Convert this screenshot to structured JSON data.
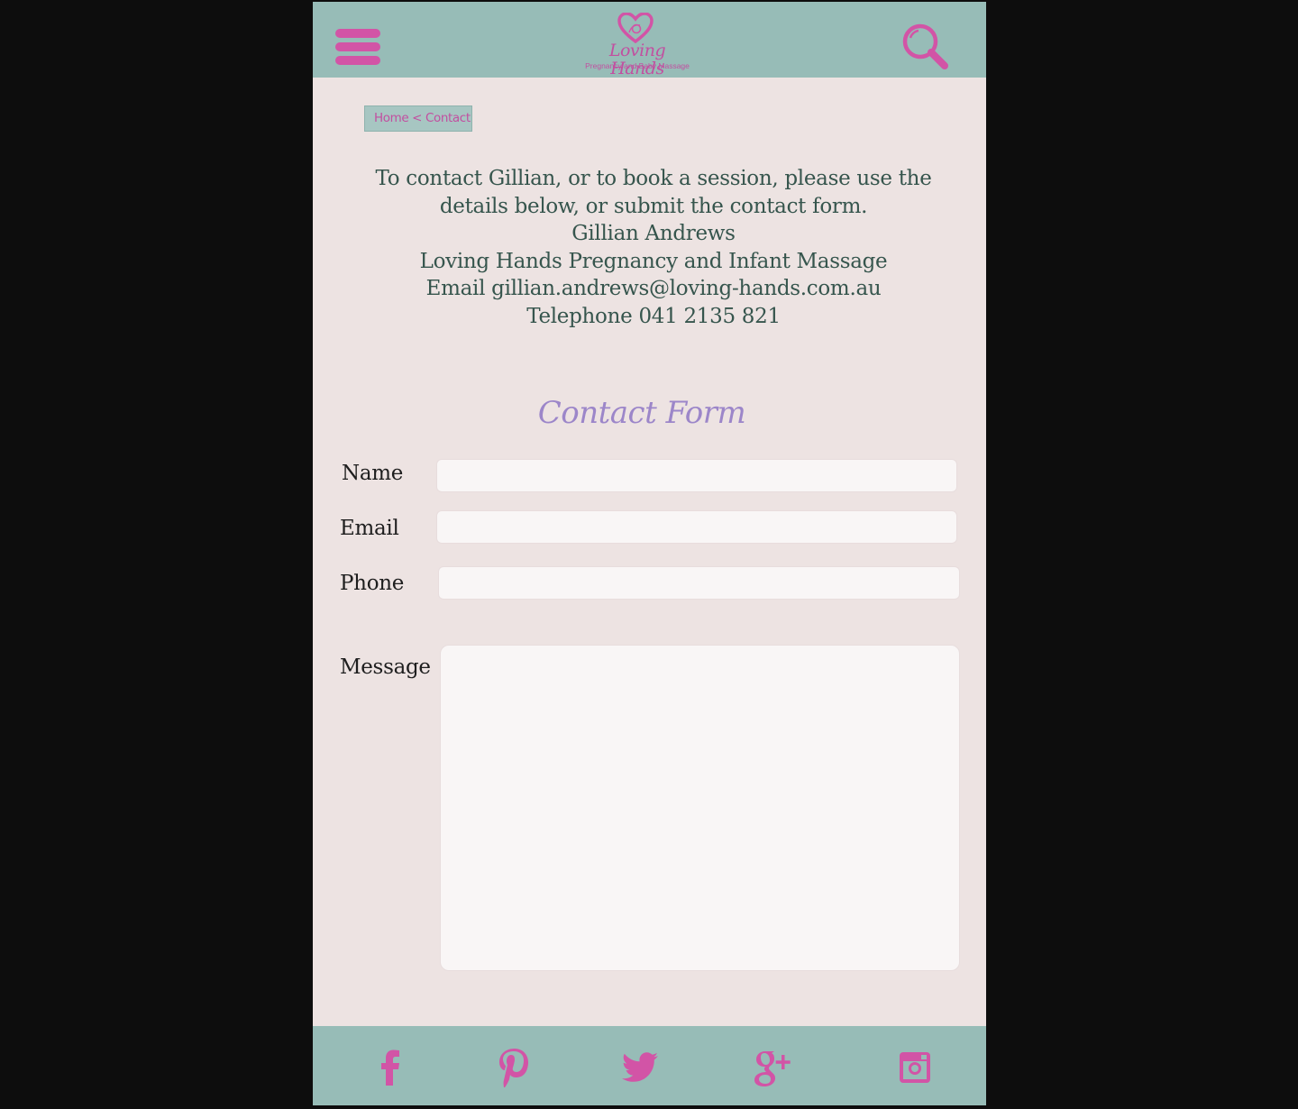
{
  "header": {
    "logo_title": "Loving Hands",
    "logo_subtitle": "Pregnancy and Baby Massage"
  },
  "breadcrumb": {
    "home": "Home",
    "separator": " < ",
    "current": "Contact"
  },
  "intro": {
    "line1": "To contact Gillian, or to book a session, please use the",
    "line2": "details below, or submit the contact form.",
    "line3": "Gillian Andrews",
    "line4": "Loving Hands Pregnancy and Infant Massage",
    "line5": "Email gillian.andrews@loving-hands.com.au",
    "line6": "Telephone  041 2135 821"
  },
  "form": {
    "title": "Contact Form",
    "name_label": "Name",
    "email_label": "Email",
    "phone_label": "Phone",
    "message_label": "Message",
    "name_value": "",
    "email_value": "",
    "phone_value": "",
    "message_value": ""
  },
  "footer": {
    "icons": [
      "facebook-icon",
      "pinterest-icon",
      "twitter-icon",
      "google-plus-icon",
      "instagram-icon"
    ]
  },
  "colors": {
    "header_bg": "#97bcb7",
    "accent_pink": "#d254a6",
    "page_bg": "#ede3e2",
    "text": "#36554d",
    "form_title": "#9c86c9"
  }
}
